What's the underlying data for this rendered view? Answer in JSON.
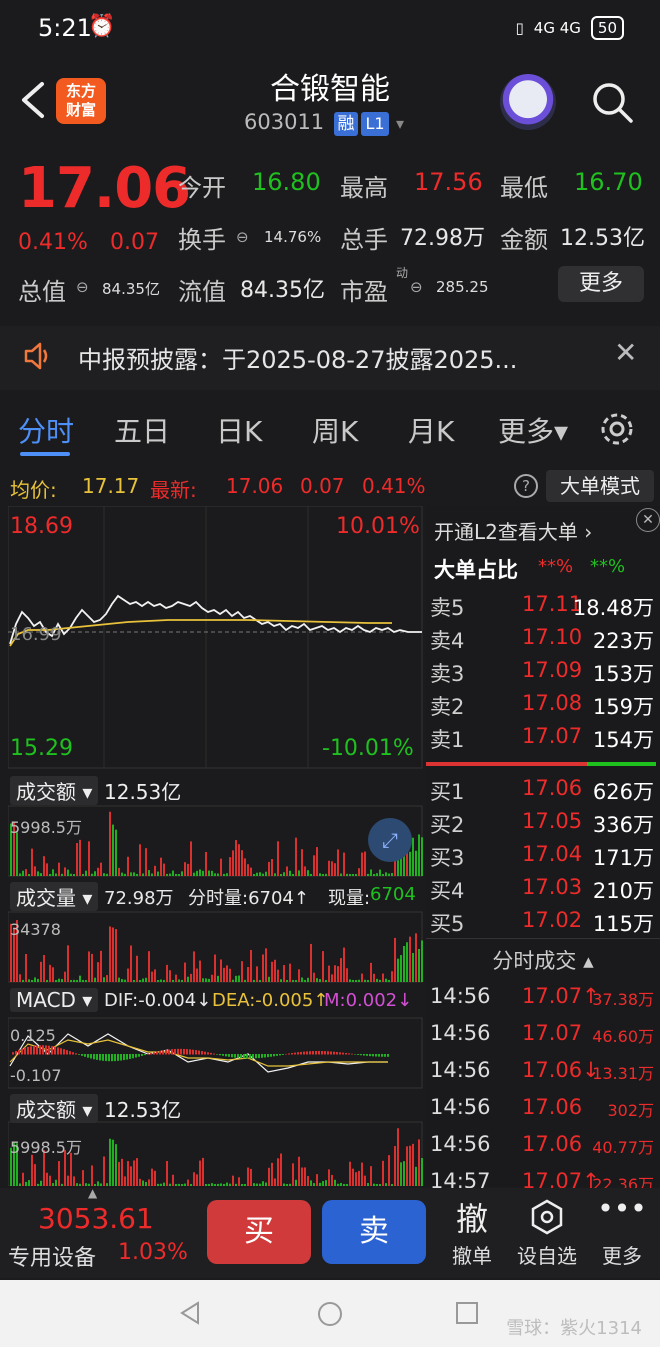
{
  "status": {
    "time": "5:21",
    "network": "4G 4G",
    "battery": "50"
  },
  "header": {
    "logo_text": "东方\n财富",
    "stock_name": "合锻智能",
    "stock_code": "603011",
    "tag_rong": "融",
    "tag_l1": "L1"
  },
  "quote": {
    "price": "17.06",
    "change_pct": "0.41%",
    "change": "0.07",
    "open_label": "今开",
    "open": "16.80",
    "high_label": "最高",
    "high": "17.56",
    "low_label": "最低",
    "low": "16.70",
    "turnover_label": "换手",
    "turnover": "14.76%",
    "volume_label": "总手",
    "volume": "72.98万",
    "amount_label": "金额",
    "amount": "12.53亿",
    "mcap_label": "总值",
    "mcap": "84.35亿",
    "float_label": "流值",
    "float": "84.35亿",
    "pe_label": "市盈",
    "pe_sup": "动",
    "pe": "285.25",
    "more": "更多"
  },
  "notice": {
    "text": "中报预披露：于2025-08-27披露2025..."
  },
  "tabs": [
    "分时",
    "五日",
    "日K",
    "周K",
    "月K",
    "更多▾"
  ],
  "avgbar": {
    "avg_label": "均价:",
    "avg": "17.17",
    "latest_label": "最新:",
    "latest": "17.06",
    "latest_chg": "0.07",
    "latest_pct": "0.41%",
    "mode_button": "大单模式"
  },
  "intraday": {
    "top_price": "18.69",
    "top_pct": "10.01%",
    "bottom_price": "15.29",
    "bottom_pct": "-10.01%",
    "mid_price": "16.99"
  },
  "panels": {
    "amount_label": "成交额",
    "amount_value": "12.53亿",
    "amount_max": "5998.5万",
    "vol_label": "成交量",
    "vol_value": "72.98万",
    "vol_minute": "分时量:6704↑",
    "vol_now_label": "现量:",
    "vol_now": "6704",
    "vol_max": "34378",
    "macd_label": "MACD",
    "dif": "DIF:-0.004↓",
    "dea": "DEA:-0.005↑",
    "m": "M:0.002↓",
    "macd_top": "0.125",
    "macd_bottom": "-0.107",
    "amount2_label": "成交额",
    "amount2_value": "12.53亿",
    "amount2_max": "5998.5万"
  },
  "orderbook": {
    "l2_link": "开通L2查看大单 ›",
    "big_ratio_label": "大单占比",
    "big_ratio_red": "**%",
    "big_ratio_green": "**%",
    "asks": [
      {
        "label": "卖5",
        "price": "17.11",
        "vol": "18.48万"
      },
      {
        "label": "卖4",
        "price": "17.10",
        "vol": "223万"
      },
      {
        "label": "卖3",
        "price": "17.09",
        "vol": "153万"
      },
      {
        "label": "卖2",
        "price": "17.08",
        "vol": "159万"
      },
      {
        "label": "卖1",
        "price": "17.07",
        "vol": "154万"
      }
    ],
    "bids": [
      {
        "label": "买1",
        "price": "17.06",
        "vol": "626万"
      },
      {
        "label": "买2",
        "price": "17.05",
        "vol": "336万"
      },
      {
        "label": "买3",
        "price": "17.04",
        "vol": "171万"
      },
      {
        "label": "买4",
        "price": "17.03",
        "vol": "210万"
      },
      {
        "label": "买5",
        "price": "17.02",
        "vol": "115万"
      }
    ]
  },
  "ticks": {
    "title": "分时成交",
    "rows": [
      {
        "time": "14:56",
        "price": "17.07↑",
        "vol": "37.38万"
      },
      {
        "time": "14:56",
        "price": "17.07",
        "vol": "46.60万"
      },
      {
        "time": "14:56",
        "price": "17.06↓",
        "vol": "13.31万"
      },
      {
        "time": "14:56",
        "price": "17.06",
        "vol": "302万"
      },
      {
        "time": "14:56",
        "price": "17.06",
        "vol": "40.77万"
      },
      {
        "time": "14:57",
        "price": "17.07↑",
        "vol": "22.36万"
      }
    ]
  },
  "tradebar": {
    "index_value": "3053.61",
    "index_name": "专用设备",
    "index_pct": "1.03%",
    "buy": "买",
    "sell": "卖",
    "cancel_icon": "撤",
    "cancel": "撤单",
    "watch": "设自选",
    "more": "更多"
  },
  "navbar": {
    "watermark": "雪球：紫火1314"
  }
}
